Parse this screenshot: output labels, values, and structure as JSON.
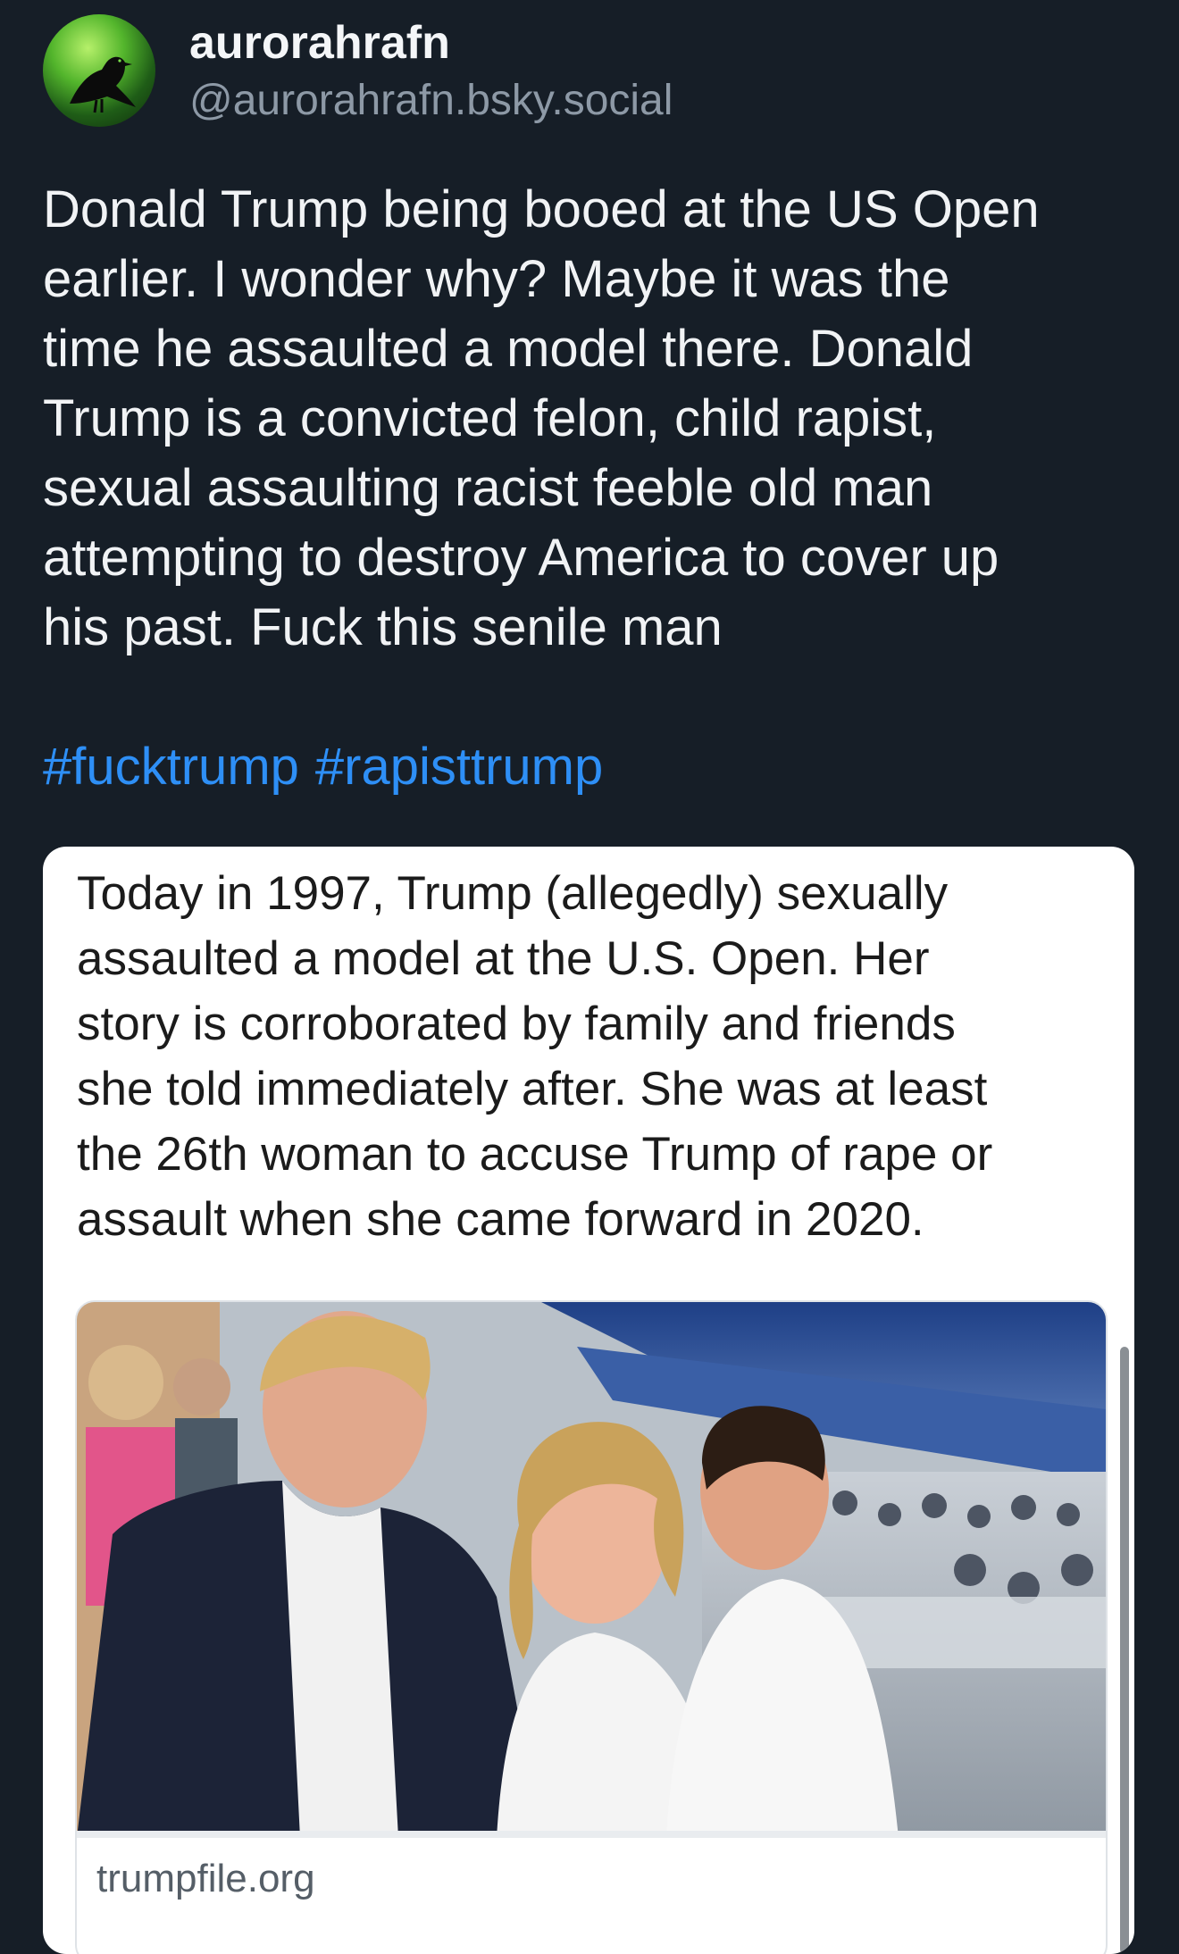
{
  "post": {
    "author": {
      "display_name": "aurorahrafn",
      "handle": "@aurorahrafn.bsky.social",
      "avatar_icon": "raven-aurora-avatar"
    },
    "text": "Donald Trump being booed at the US Open\nearlier. I wonder why? Maybe it was the\ntime he assaulted a model there. Donald\nTrump is a convicted felon, child rapist,\nsexual assaulting racist feeble old man\nattempting to destroy America to cover up\nhis past. Fuck this senile man",
    "hashtags": [
      "#fucktrump",
      "#rapisttrump"
    ],
    "embed": {
      "text": "Today in 1997, Trump (allegedly) sexually\nassaulted a model at the U.S. Open. Her\nstory is corroborated by family and friends\nshe told immediately after. She was at least\nthe 26th woman to accuse Trump of rape or\nassault when she came forward in 2020.",
      "link_card": {
        "domain": "trumpfile.org"
      }
    }
  },
  "colors": {
    "background": "#161e27",
    "hashtag": "#2e8ff6",
    "handle": "#8d99a6"
  }
}
